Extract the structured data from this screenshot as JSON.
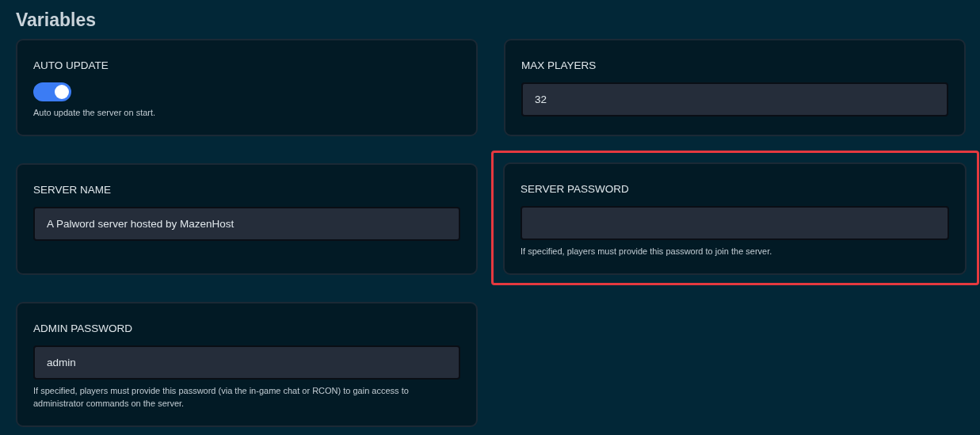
{
  "title": "Variables",
  "variables": [
    {
      "kind": "toggle",
      "label": "AUTO UPDATE",
      "on": true,
      "description": "Auto update the server on start.",
      "highlighted": false
    },
    {
      "kind": "text",
      "label": "MAX PLAYERS",
      "value": "32",
      "highlighted": false
    },
    {
      "kind": "text",
      "label": "SERVER NAME",
      "value": "A Palword server hosted by MazenHost",
      "highlighted": false
    },
    {
      "kind": "text",
      "label": "SERVER PASSWORD",
      "description": "If specified, players must provide this password to join the server.",
      "highlighted": true
    },
    {
      "kind": "text",
      "label": "ADMIN PASSWORD",
      "value": "admin",
      "description": "If specified, players must provide this password (via the in-game chat or RCON) to gain access to administrator commands on the server.",
      "highlighted": false
    }
  ]
}
